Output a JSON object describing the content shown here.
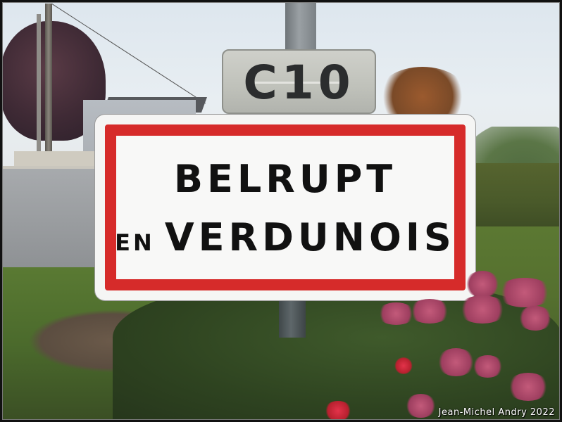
{
  "road_plate": {
    "text": "C10"
  },
  "sign": {
    "line1": "BELRUPT",
    "line2_prefix": "EN",
    "line2_main": "VERDUNOIS"
  },
  "credit": "Jean-Michel Andry 2022",
  "colors": {
    "sign_red": "#d62b2a",
    "sign_white": "#f8f8f7",
    "plate_grey": "#c4c6c0"
  }
}
